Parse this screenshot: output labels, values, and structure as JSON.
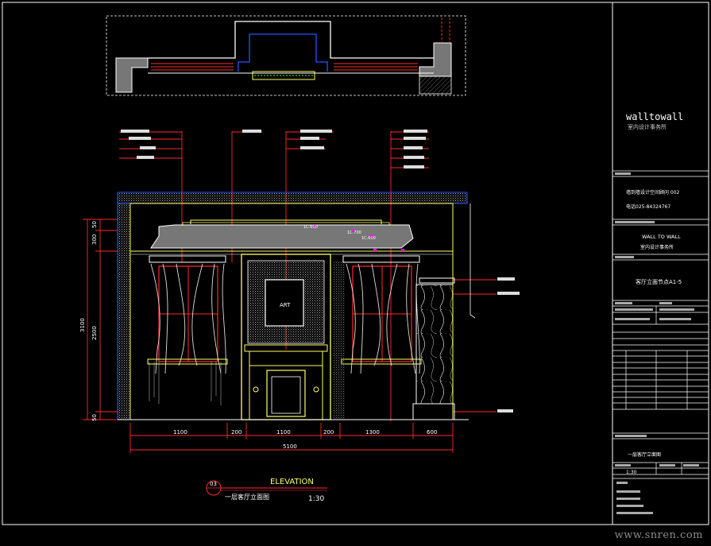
{
  "drawing": {
    "title_text": "ELEVATION",
    "scale": "1:30",
    "view_number": "03",
    "view_name": "一层客厅立面图",
    "art_label": "ART"
  },
  "dimensions": {
    "horizontal": [
      "1100",
      "200",
      "1100",
      "200",
      "1300",
      "600"
    ],
    "total": "5100",
    "vertical": [
      "50",
      "300",
      "2500",
      "50"
    ],
    "vertical_total": "3100",
    "callout_values": [
      "1C.600",
      "1C.700",
      "1C.600"
    ]
  },
  "title_block": {
    "company_logo": "walltowall",
    "company_sub": "室内设计事务所",
    "project_line1": "墙到墙设计空间顾问  002",
    "project_line2": "电话025-84324767",
    "company_en": "WALL TO WALL",
    "company_cn": "室内设计事务所",
    "sheet_code": "客厅立面节点A1-5",
    "scale_value": "1:30",
    "drawing_name": "一层客厅立面图"
  },
  "watermark": "www.snren.com",
  "colors": {
    "background": "#000000",
    "frame": "#ffffff",
    "wall": "#ffff66",
    "dimension": "#ff2a2a",
    "outline_blue": "#2255ff",
    "magenta": "#ff00ff",
    "hatch": "#8888aa",
    "fill_gray": "#777777"
  }
}
